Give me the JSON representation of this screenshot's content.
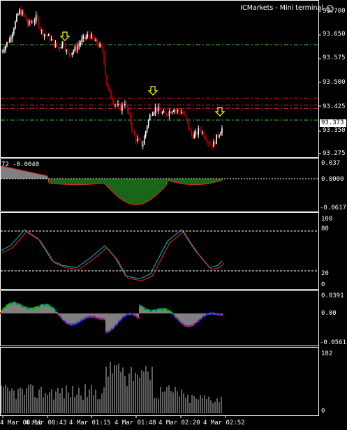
{
  "window": {
    "title": "ICMarkets - Mini terminal",
    "smiley_icon": "smiley-face-icon"
  },
  "colors": {
    "bg": "#000000",
    "grid_border": "#ffffff",
    "bull_candle": "#ffffff",
    "bear_candle": "#c00000",
    "green_level": "#32cd32",
    "red_level": "#ff2020",
    "arrow": "#ffff00",
    "macd_line": "#ff2020",
    "macd_hist": "#32cd32",
    "stoch_main": "#00bcd4",
    "stoch_signal": "#ff2020",
    "volume": "#c0c0c0"
  },
  "price_panel": {
    "ticks": [
      "93.700",
      "93.650",
      "93.575",
      "93.500",
      "93.425",
      "93.350",
      "93.275"
    ],
    "current_price": "93.373",
    "levels": {
      "green_upper": 93.6,
      "red_1": 93.44,
      "red_2": 93.42,
      "red_3": 93.41,
      "green_lower": 93.375
    },
    "arrows_icon": "down-arrow-icon"
  },
  "macd_panel": {
    "label": "72 -0.0040",
    "ticks": [
      "0.037",
      "0.0000",
      "-0.0617"
    ]
  },
  "stoch_panel": {
    "ticks": [
      "100",
      "80",
      "20",
      "0"
    ]
  },
  "osc_panel": {
    "ticks": [
      "0.0391",
      "0.00",
      "-0.0561"
    ]
  },
  "volume_panel": {
    "ticks": [
      "182",
      "0"
    ]
  },
  "time_axis": {
    "labels": [
      "4 Mar 00:11",
      "4 Mar 00:43",
      "4 Mar 01:15",
      "4 Mar 01:48",
      "4 Mar 02:20",
      "4 Mar 02:52"
    ]
  },
  "chart_data": {
    "type": "candlestick",
    "symbol_last": 93.373,
    "close_path": [
      93.58,
      93.6,
      93.62,
      93.66,
      93.7,
      93.69,
      93.66,
      93.67,
      93.68,
      93.64,
      93.63,
      93.62,
      93.6,
      93.59,
      93.61,
      93.57,
      93.58,
      93.59,
      93.61,
      93.62,
      93.63,
      93.61,
      93.6,
      93.58,
      93.47,
      93.44,
      93.42,
      93.41,
      93.43,
      93.38,
      93.33,
      93.31,
      93.3,
      93.36,
      93.4,
      93.41,
      93.4,
      93.39,
      93.4,
      93.41,
      93.4,
      93.4,
      93.37,
      93.33,
      93.33,
      93.35,
      93.33,
      93.31,
      93.3,
      93.33,
      93.35
    ],
    "macd_range": [
      -0.0617,
      0.037
    ],
    "stoch_levels": [
      80,
      20
    ],
    "volume_max": 182
  }
}
